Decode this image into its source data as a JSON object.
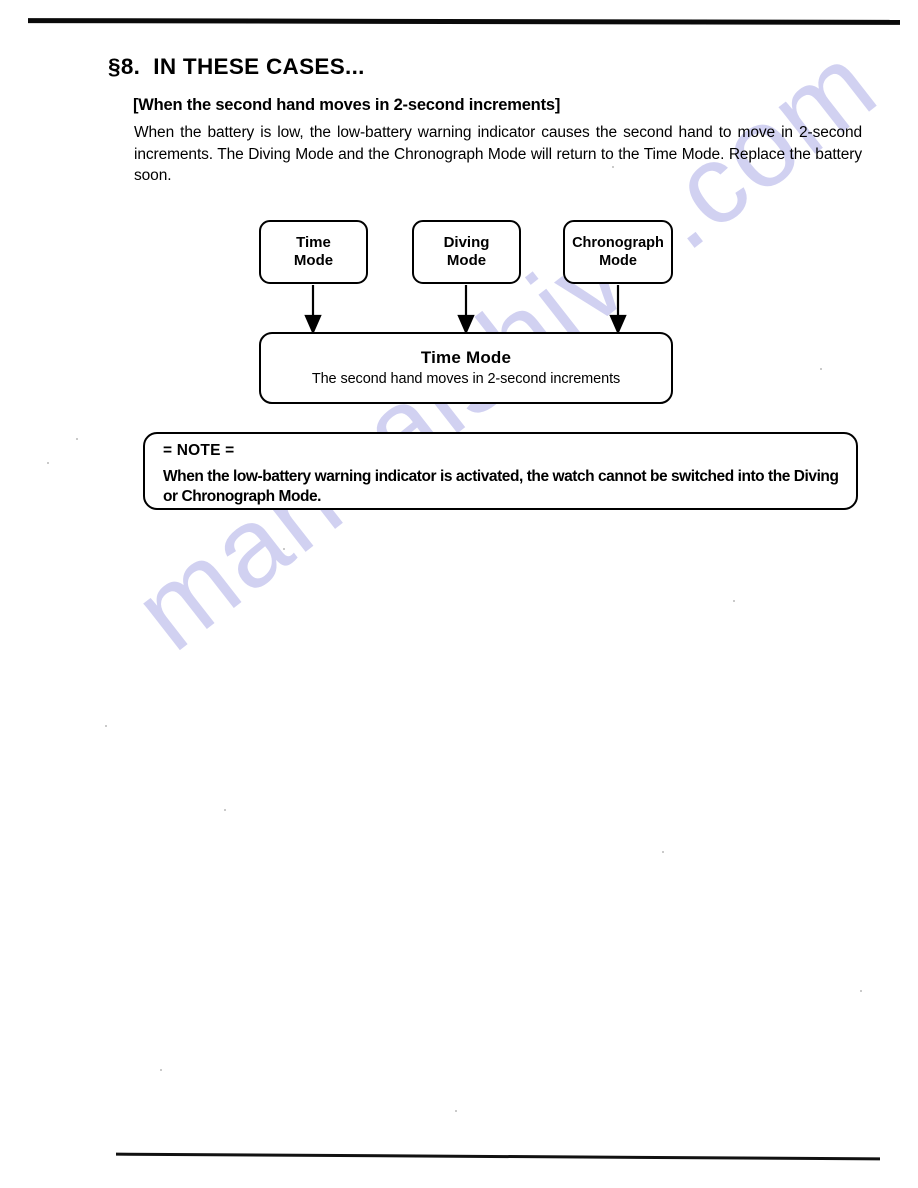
{
  "page": {
    "section_number": "§8.",
    "section_title": "IN THESE CASES...",
    "section_heading_full": "§8.  IN THESE CASES...",
    "subsection_title": "[When the second hand moves in 2-second increments]",
    "body_paragraph": "When the battery is low, the low-battery warning indicator causes the second hand to move in 2-second increments. The Diving Mode and the Chronograph Mode will return to the Time Mode. Replace the battery soon.",
    "watermark": "manualshive.com"
  },
  "diagram": {
    "source_modes": [
      {
        "label": "Time\nMode",
        "name": "time-mode"
      },
      {
        "label": "Diving\nMode",
        "name": "diving-mode"
      },
      {
        "label": "Chronograph\nMode",
        "name": "chronograph-mode"
      }
    ],
    "result": {
      "title": "Time Mode",
      "subtitle": "The second hand moves in 2-second increments"
    },
    "arrow_count": 3,
    "line_color": "#000000"
  },
  "note": {
    "header": "= NOTE =",
    "text": "When the low-battery warning indicator is activated, the watch cannot be switched into the Diving or Chronograph Mode."
  },
  "colors": {
    "ink": "#000000",
    "page_background": "#ffffff",
    "watermark": "#c9c9ef",
    "rule": "#0a0a0a"
  }
}
